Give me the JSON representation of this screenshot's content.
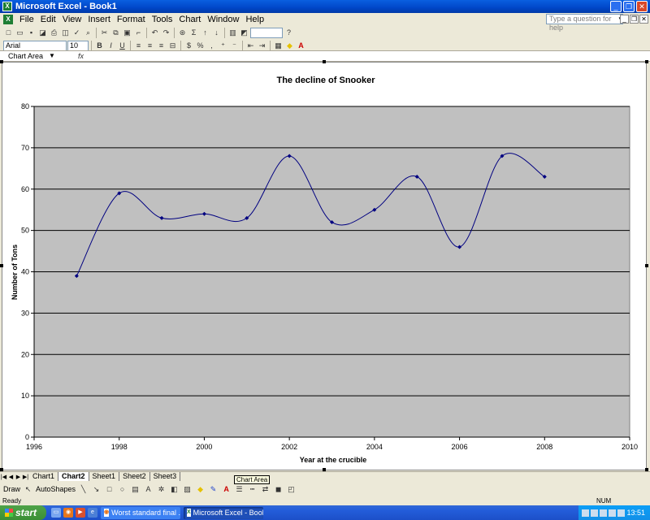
{
  "window": {
    "title": "Microsoft Excel - Book1"
  },
  "menu": [
    "File",
    "Edit",
    "View",
    "Insert",
    "Format",
    "Tools",
    "Chart",
    "Window",
    "Help"
  ],
  "help_placeholder": "Type a question for help",
  "format": {
    "font": "Arial",
    "size": "10",
    "bold": "B",
    "italic": "I",
    "underline": "U"
  },
  "namebox": "Chart Area",
  "fx_label": "fx",
  "chart_data": {
    "type": "line",
    "title": "The decline of Snooker",
    "xlabel": "Year at the crucible",
    "ylabel": "Number of Tons",
    "x": [
      1997,
      1998,
      1999,
      2000,
      2001,
      2002,
      2003,
      2004,
      2005,
      2006,
      2007,
      2008
    ],
    "series": [
      {
        "values": [
          39,
          59,
          53,
          54,
          53,
          68,
          52,
          55,
          63,
          46,
          68,
          63
        ]
      }
    ],
    "xlim": [
      1996,
      2010
    ],
    "ylim": [
      0,
      80
    ],
    "xticks": [
      "1996",
      "1998",
      "2000",
      "2002",
      "2004",
      "2006",
      "2008",
      "2010"
    ],
    "yticks": [
      "0",
      "10",
      "20",
      "30",
      "40",
      "50",
      "60",
      "70",
      "80"
    ],
    "grid": "horizontal",
    "plot_bg": "#c0c0c0",
    "line_color": "#000080"
  },
  "sheets": [
    "Chart1",
    "Chart2",
    "Sheet1",
    "Sheet2",
    "Sheet3"
  ],
  "active_sheet": "Chart2",
  "drawbar": {
    "draw": "Draw",
    "autoshapes": "AutoShapes"
  },
  "tooltip": "Chart Area",
  "status": {
    "left": "Ready",
    "num": "NUM"
  },
  "taskbar": {
    "start": "start",
    "tasks": [
      {
        "label": "Worst standard final ...",
        "active": false
      },
      {
        "label": "Microsoft Excel - Book1",
        "active": true
      }
    ],
    "clock": "13:51"
  }
}
